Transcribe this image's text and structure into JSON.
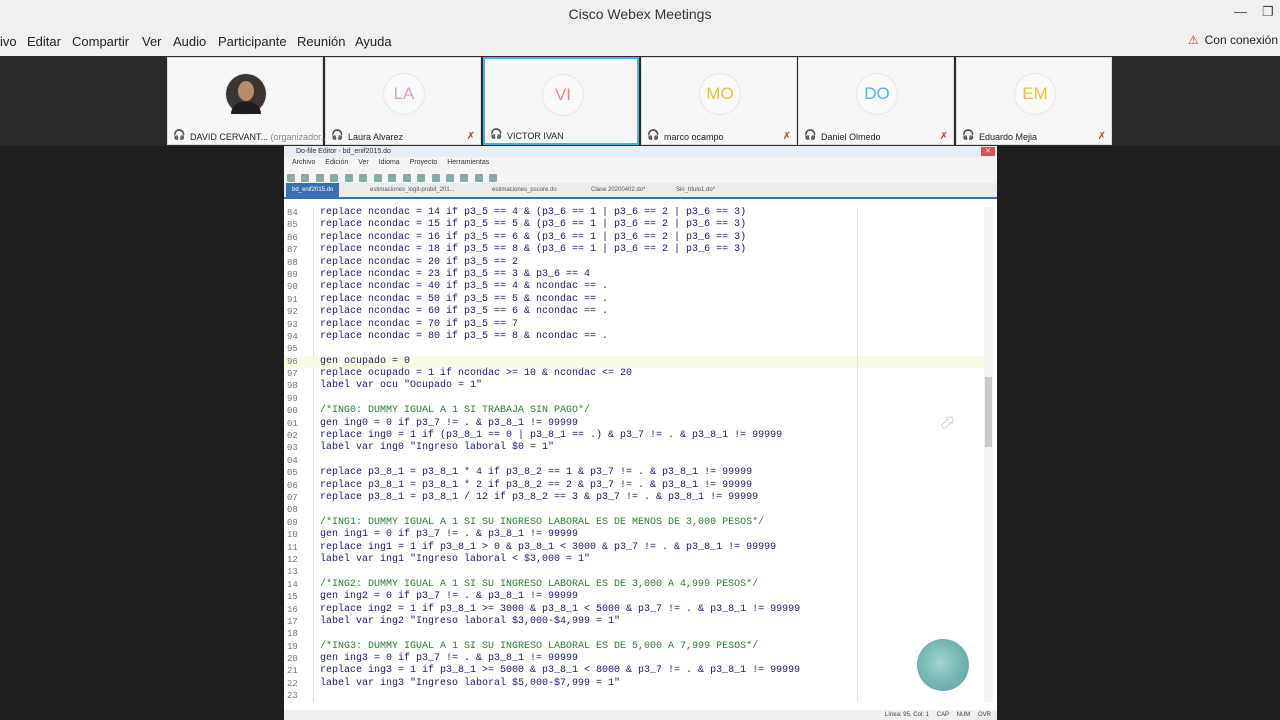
{
  "app_title": "Cisco Webex Meetings",
  "menu": [
    "ivo",
    "Editar",
    "Compartir",
    "Ver",
    "Audio",
    "Participante",
    "Reunión",
    "Ayuda"
  ],
  "connection_status": "Con conexión",
  "participants": [
    {
      "initials": "",
      "name": "DAVID CERVANT...",
      "role": "(organizador...)",
      "muted": false,
      "active": false,
      "photo": true
    },
    {
      "initials": "LA",
      "name": "Laura Alvarez",
      "muted": true,
      "active": false,
      "color": "#d9a5c5"
    },
    {
      "initials": "VI",
      "name": "VICTOR IVAN",
      "muted": false,
      "active": true,
      "color": "#e88a7f"
    },
    {
      "initials": "MO",
      "name": "marco ocampo",
      "muted": true,
      "active": false,
      "color": "#f1c232"
    },
    {
      "initials": "DO",
      "name": "Daniel Olmedo",
      "muted": true,
      "active": false,
      "color": "#4fb3e0"
    },
    {
      "initials": "EM",
      "name": "Eduardo Mejia",
      "muted": true,
      "active": false,
      "color": "#f1c232"
    }
  ],
  "editor": {
    "title": "Do-file Editor - bd_enif2015.do",
    "menu": [
      "Archivo",
      "Edición",
      "Ver",
      "Idioma",
      "Proyecto",
      "Herramientas"
    ],
    "tabs": [
      "bd_enif2015.do",
      "estimaciones_logit-probit_201...",
      "estimaciones_pscore.do",
      "Clase 20200402.do*",
      "Sin_título1.do*"
    ],
    "active_tab": 0,
    "status": [
      "Línea: 95, Col: 1",
      "CAP",
      "NUM",
      "OVR"
    ],
    "lines": [
      {
        "n": "84",
        "t": "replace ncondac = 14 if p3_5 == 4 & (p3_6 == 1 | p3_6 == 2 | p3_6 == 3)",
        "c": "kw"
      },
      {
        "n": "85",
        "t": "replace ncondac = 15 if p3_5 == 5 & (p3_6 == 1 | p3_6 == 2 | p3_6 == 3)",
        "c": "kw"
      },
      {
        "n": "86",
        "t": "replace ncondac = 16 if p3_5 == 6 & (p3_6 == 1 | p3_6 == 2 | p3_6 == 3)",
        "c": "kw"
      },
      {
        "n": "87",
        "t": "replace ncondac = 18 if p3_5 == 8 & (p3_6 == 1 | p3_6 == 2 | p3_6 == 3)",
        "c": "kw"
      },
      {
        "n": "88",
        "t": "replace ncondac = 20 if p3_5 == 2",
        "c": "kw"
      },
      {
        "n": "89",
        "t": "replace ncondac = 23 if p3_5 == 3 & p3_6 == 4",
        "c": "kw"
      },
      {
        "n": "90",
        "t": "replace ncondac = 40 if p3_5 == 4 & ncondac == .",
        "c": "kw"
      },
      {
        "n": "91",
        "t": "replace ncondac = 50 if p3_5 == 5 & ncondac == .",
        "c": "kw"
      },
      {
        "n": "92",
        "t": "replace ncondac = 60 if p3_5 == 6 & ncondac == .",
        "c": "kw"
      },
      {
        "n": "93",
        "t": "replace ncondac = 70 if p3_5 == 7",
        "c": "kw"
      },
      {
        "n": "94",
        "t": "replace ncondac = 80 if p3_5 == 8 & ncondac == .",
        "c": "kw"
      },
      {
        "n": "95",
        "t": "",
        "c": "kw"
      },
      {
        "n": "96",
        "t": "gen ocupado = 0",
        "c": "kw",
        "hl": true
      },
      {
        "n": "97",
        "t": "replace ocupado = 1 if ncondac >= 10 & ncondac <= 20",
        "c": "kw"
      },
      {
        "n": "98",
        "t": "label var ocu \"Ocupado = 1\"",
        "c": "kw"
      },
      {
        "n": "99",
        "t": "",
        "c": "kw"
      },
      {
        "n": "00",
        "t": "/*ING0: DUMMY IGUAL A 1 SI TRABAJA SIN PAGO*/",
        "c": "cm"
      },
      {
        "n": "01",
        "t": "gen ing0 = 0 if p3_7 != . & p3_8_1 != 99999",
        "c": "kw"
      },
      {
        "n": "02",
        "t": "replace ing0 = 1 if (p3_8_1 == 0 | p3_8_1 == .) & p3_7 != . & p3_8_1 != 99999",
        "c": "kw"
      },
      {
        "n": "03",
        "t": "label var ing0 \"Ingreso laboral $0 = 1\"",
        "c": "kw"
      },
      {
        "n": "04",
        "t": "",
        "c": "kw"
      },
      {
        "n": "05",
        "t": "replace p3_8_1 = p3_8_1 * 4 if p3_8_2 == 1 & p3_7 != . & p3_8_1 != 99999",
        "c": "kw"
      },
      {
        "n": "06",
        "t": "replace p3_8_1 = p3_8_1 * 2 if p3_8_2 == 2 & p3_7 != . & p3_8_1 != 99999",
        "c": "kw"
      },
      {
        "n": "07",
        "t": "replace p3_8_1 = p3_8_1 / 12 if p3_8_2 == 3 & p3_7 != . & p3_8_1 != 99999",
        "c": "kw"
      },
      {
        "n": "08",
        "t": "",
        "c": "kw"
      },
      {
        "n": "09",
        "t": "/*ING1: DUMMY IGUAL A 1 SI SU INGRESO LABORAL ES DE MENOS DE 3,000 PESOS*/",
        "c": "cm"
      },
      {
        "n": "10",
        "t": "gen ing1 = 0 if p3_7 != . & p3_8_1 != 99999",
        "c": "kw"
      },
      {
        "n": "11",
        "t": "replace ing1 = 1 if p3_8_1 > 0 & p3_8_1 < 3000 & p3_7 != . & p3_8_1 != 99999",
        "c": "kw"
      },
      {
        "n": "12",
        "t": "label var ing1 \"Ingreso laboral < $3,000 = 1\"",
        "c": "kw"
      },
      {
        "n": "13",
        "t": "",
        "c": "kw"
      },
      {
        "n": "14",
        "t": "/*ING2: DUMMY IGUAL A 1 SI SU INGRESO LABORAL ES DE 3,000 A 4,999 PESOS*/",
        "c": "cm"
      },
      {
        "n": "15",
        "t": "gen ing2 = 0 if p3_7 != . & p3_8_1 != 99999",
        "c": "kw"
      },
      {
        "n": "16",
        "t": "replace ing2 = 1 if p3_8_1 >= 3000 & p3_8_1 < 5000 & p3_7 != . & p3_8_1 != 99999",
        "c": "kw"
      },
      {
        "n": "17",
        "t": "label var ing2 \"Ingreso laboral $3,000-$4,999 = 1\"",
        "c": "kw"
      },
      {
        "n": "18",
        "t": "",
        "c": "kw"
      },
      {
        "n": "19",
        "t": "/*ING3: DUMMY IGUAL A 1 SI SU INGRESO LABORAL ES DE 5,000 A 7,999 PESOS*/",
        "c": "cm"
      },
      {
        "n": "20",
        "t": "gen ing3 = 0 if p3_7 != . & p3_8_1 != 99999",
        "c": "kw"
      },
      {
        "n": "21",
        "t": "replace ing3 = 1 if p3_8_1 >= 5000 & p3_8_1 < 8000 & p3_7 != . & p3_8_1 != 99999",
        "c": "kw"
      },
      {
        "n": "22",
        "t": "label var ing3 \"Ingreso laboral $5,000-$7,999 = 1\"",
        "c": "kw"
      },
      {
        "n": "23",
        "t": "",
        "c": "kw"
      }
    ]
  }
}
